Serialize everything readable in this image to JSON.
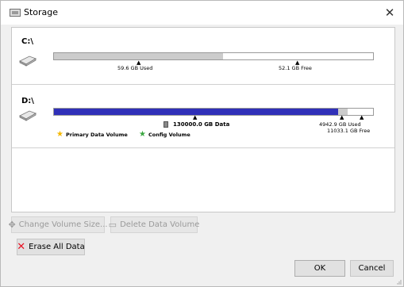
{
  "window": {
    "title": "Storage",
    "close_glyph": "✕"
  },
  "volumes": {
    "c": {
      "name": "C:\\",
      "used_label": "59.6 GB Used",
      "free_label": "52.1 GB Free",
      "used_fraction": 0.53,
      "colors": {
        "used": "#cccccc",
        "free": "#ffffff"
      }
    },
    "d": {
      "name": "D:\\",
      "data_label": "130000.0 GB Data",
      "used_label": "4942.9 GB Used",
      "free_label": "11033.1 GB Free",
      "data_fraction": 0.89,
      "used_fraction": 0.03,
      "colors": {
        "data": "#3030b8",
        "used": "#cccccc",
        "free": "#ffffff"
      },
      "legend": [
        {
          "icon": "star-icon",
          "color": "#f5b800",
          "label": "Primary Data Volume"
        },
        {
          "icon": "star-icon",
          "color": "#3aa640",
          "label": "Config Volume"
        }
      ]
    }
  },
  "buttons": {
    "change_volume_size": "Change Volume Size...",
    "delete_data_volume": "Delete Data Volume",
    "erase_all_data": "Erase All Data",
    "ok": "OK",
    "cancel": "Cancel"
  }
}
